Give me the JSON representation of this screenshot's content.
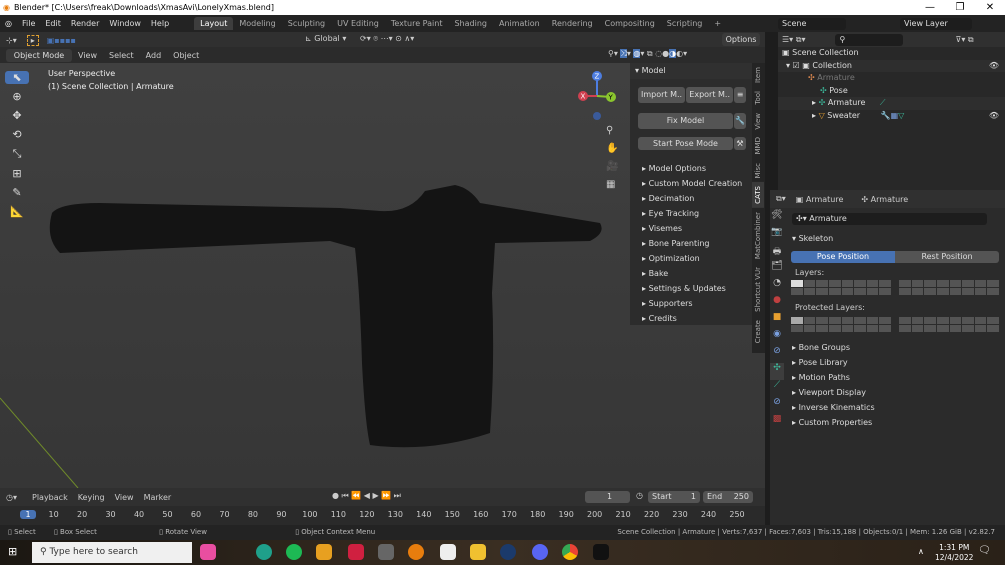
{
  "window": {
    "title": "Blender* [C:\\Users\\freak\\Downloads\\XmasAvi\\LonelyXmas.blend]",
    "min": "—",
    "max": "❐",
    "close": "✕"
  },
  "menu": [
    "File",
    "Edit",
    "Render",
    "Window",
    "Help"
  ],
  "workspaces": [
    "Layout",
    "Modeling",
    "Sculpting",
    "UV Editing",
    "Texture Paint",
    "Shading",
    "Animation",
    "Rendering",
    "Compositing",
    "Scripting",
    "+"
  ],
  "scene": "Scene",
  "view_layer": "View Layer",
  "viewport": {
    "transform": "Global",
    "options": "Options",
    "mode": "Object Mode",
    "menus": [
      "View",
      "Select",
      "Add",
      "Object"
    ],
    "perspective": "User Perspective",
    "context": "(1) Scene Collection | Armature",
    "gizmo": {
      "x": "X",
      "y": "Y",
      "z": "Z"
    }
  },
  "npanel": {
    "title": "Model",
    "import": "Import M..",
    "export": "Export M..",
    "fix": "Fix Model",
    "pose": "Start Pose Mode",
    "items": [
      "Model Options",
      "Custom Model Creation",
      "Decimation",
      "Eye Tracking",
      "Visemes",
      "Bone Parenting",
      "Optimization",
      "Bake",
      "Settings & Updates",
      "Supporters",
      "Credits"
    ]
  },
  "vtabs": [
    "Item",
    "Tool",
    "View",
    "MMD",
    "Misc",
    "CATS",
    "MatCombiner",
    "Shortcut VUr",
    "Create"
  ],
  "outliner": {
    "rows": [
      "Scene Collection",
      "Collection",
      "Armature",
      "Pose",
      "Armature",
      "Sweater"
    ]
  },
  "properties": {
    "object": "Armature",
    "data": "Armature",
    "name": "Armature",
    "skeleton": "Skeleton",
    "pose_position": "Pose Position",
    "rest_position": "Rest Position",
    "layers": "Layers:",
    "protected_layers": "Protected Layers:",
    "sections": [
      "Bone Groups",
      "Pose Library",
      "Motion Paths",
      "Viewport Display",
      "Inverse Kinematics",
      "Custom Properties"
    ]
  },
  "timeline": {
    "menus": [
      "Playback",
      "Keying",
      "View",
      "Marker"
    ],
    "current_frame": "1",
    "start_label": "Start",
    "start": "1",
    "end_label": "End",
    "end": "250",
    "ticks": [
      "1",
      "10",
      "20",
      "30",
      "40",
      "50",
      "60",
      "70",
      "80",
      "90",
      "100",
      "110",
      "120",
      "130",
      "140",
      "150",
      "160",
      "170",
      "180",
      "190",
      "200",
      "210",
      "220",
      "230",
      "240",
      "250"
    ]
  },
  "status": {
    "select": "Select",
    "box_select": "Box Select",
    "rotate": "Rotate View",
    "context_menu": "Object Context Menu",
    "stats": "Scene Collection | Armature | Verts:7,637 | Faces:7,603 | Tris:15,188 | Objects:0/1 | Mem: 1.26 GiB | v2.82.7"
  },
  "taskbar": {
    "search": "Type here to search",
    "time": "1:31 PM",
    "date": "12/4/2022"
  },
  "colors": {
    "accent": "#4772b3",
    "bg": "#303030"
  }
}
